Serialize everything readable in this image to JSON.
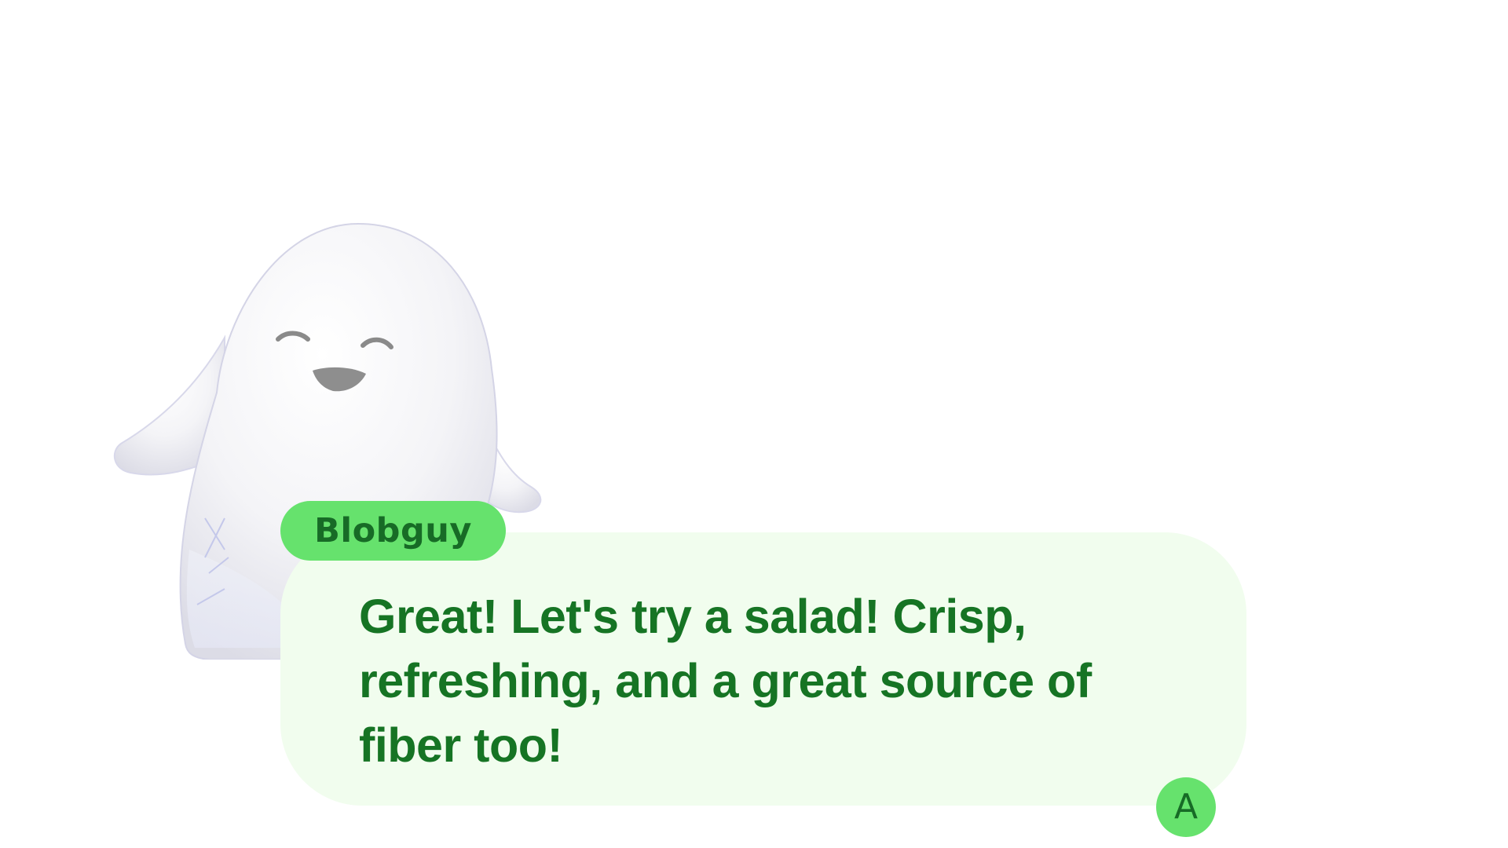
{
  "character": {
    "icon": "ghost-blob-character"
  },
  "dialog": {
    "speaker": "Blobguy",
    "text": "Great! Let's try a salad! Crisp, refreshing, and a great source of fiber too!",
    "advance_key": "A"
  },
  "colors": {
    "accent": "#66e26d",
    "text": "#167424",
    "bubble": "#f1fdee"
  }
}
